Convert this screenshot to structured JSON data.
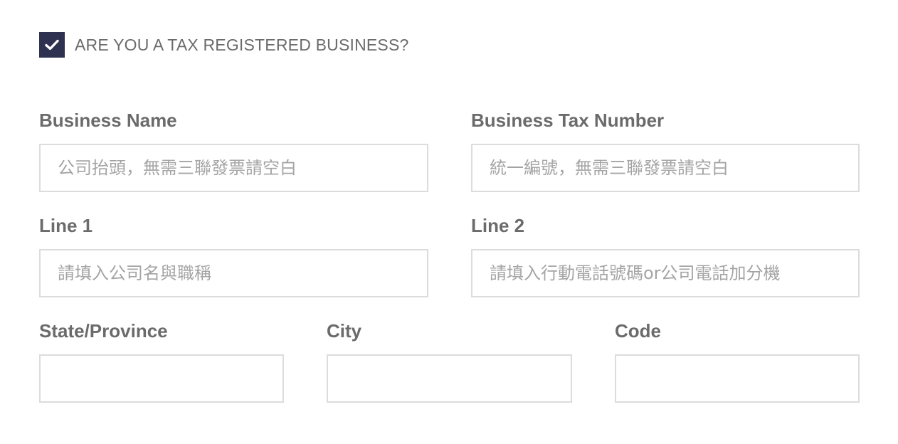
{
  "tax_registered": {
    "label": "ARE YOU A TAX REGISTERED BUSINESS?",
    "checked": true,
    "accent_color": "#2e3150"
  },
  "business_name": {
    "label": "Business Name",
    "placeholder": "公司抬頭，無需三聯發票請空白",
    "value": ""
  },
  "business_tax_number": {
    "label": "Business Tax Number",
    "placeholder": "統一編號，無需三聯發票請空白",
    "value": ""
  },
  "line1": {
    "label": "Line 1",
    "placeholder": "請填入公司名與職稱",
    "value": ""
  },
  "line2": {
    "label": "Line 2",
    "placeholder": "請填入行動電話號碼or公司電話加分機",
    "value": ""
  },
  "state_province": {
    "label": "State/Province",
    "placeholder": "",
    "value": ""
  },
  "city": {
    "label": "City",
    "placeholder": "",
    "value": ""
  },
  "code": {
    "label": "Code",
    "placeholder": "",
    "value": ""
  }
}
